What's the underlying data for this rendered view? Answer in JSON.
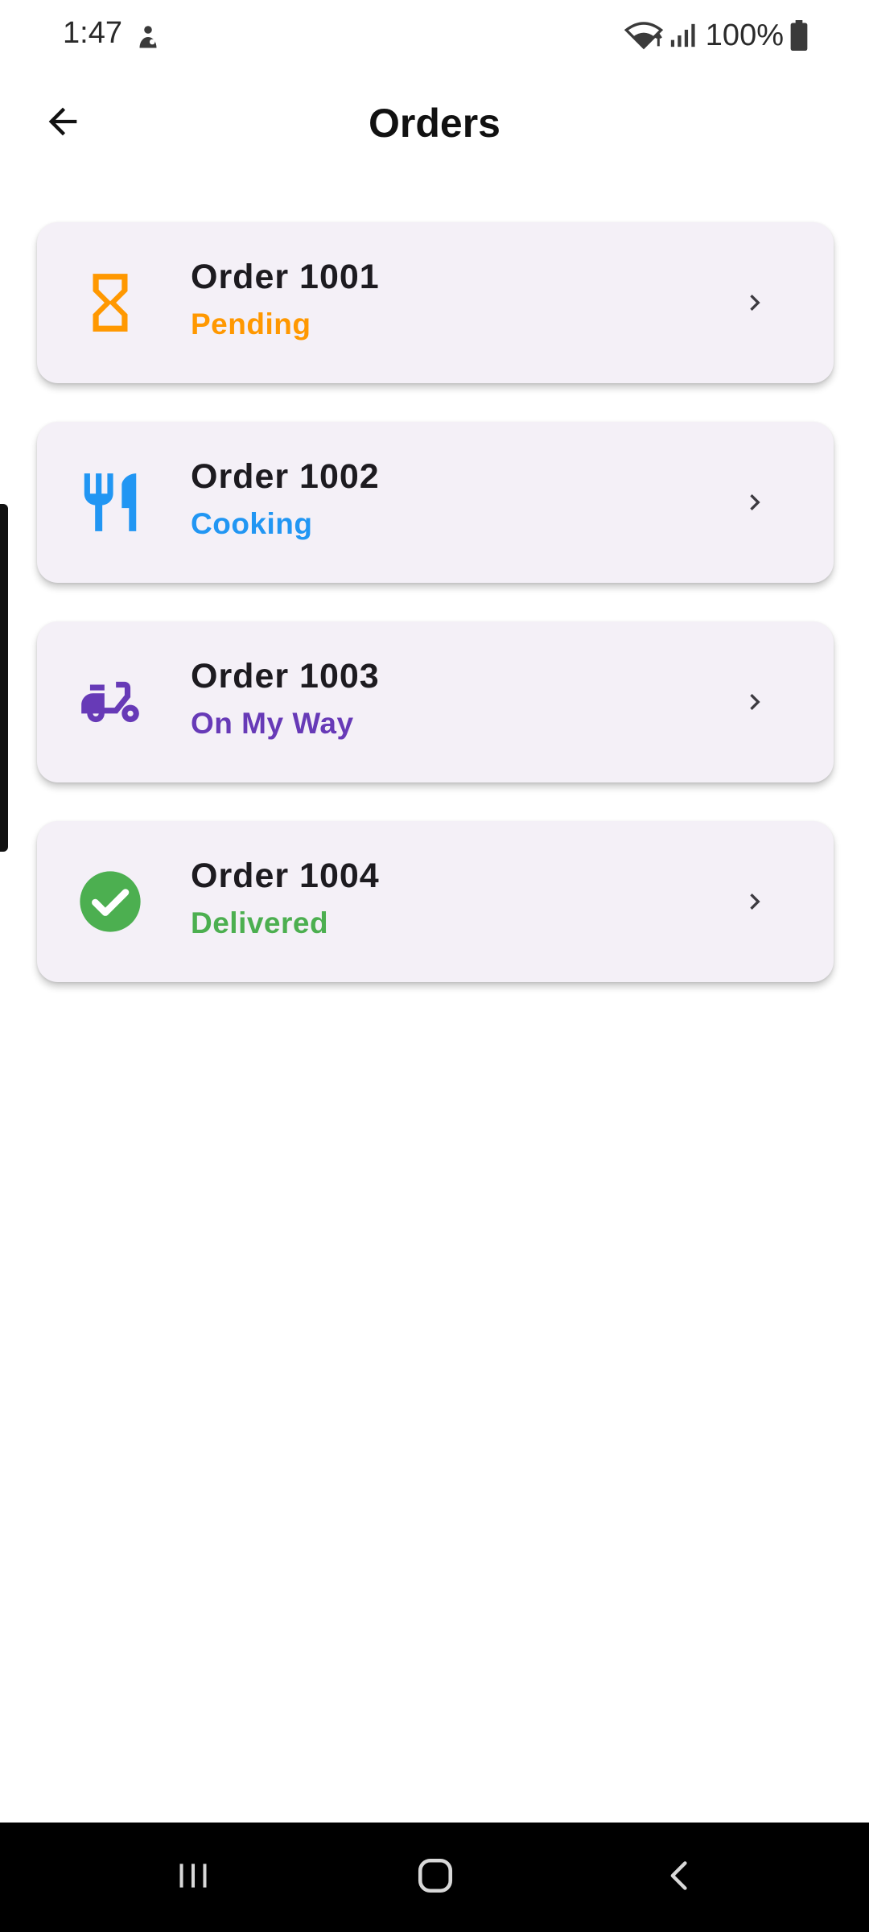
{
  "status_bar": {
    "time": "1:47",
    "battery": "100%",
    "icons": [
      "notification-icon",
      "wifi-icon",
      "signal-icon",
      "battery-icon"
    ]
  },
  "app_bar": {
    "title": "Orders",
    "back_icon": "arrow-back-icon"
  },
  "orders": [
    {
      "title": "Order 1001",
      "status": "Pending",
      "status_color": "#FF9800",
      "icon": "hourglass-icon"
    },
    {
      "title": "Order 1002",
      "status": "Cooking",
      "status_color": "#2196F3",
      "icon": "restaurant-icon"
    },
    {
      "title": "Order 1003",
      "status": "On My Way",
      "status_color": "#673AB7",
      "icon": "delivery-scooter-icon"
    },
    {
      "title": "Order 1004",
      "status": "Delivered",
      "status_color": "#4CAF50",
      "icon": "check-circle-icon"
    }
  ],
  "nav_bar": {
    "buttons": [
      "recent-apps-icon",
      "home-icon",
      "back-icon"
    ]
  }
}
